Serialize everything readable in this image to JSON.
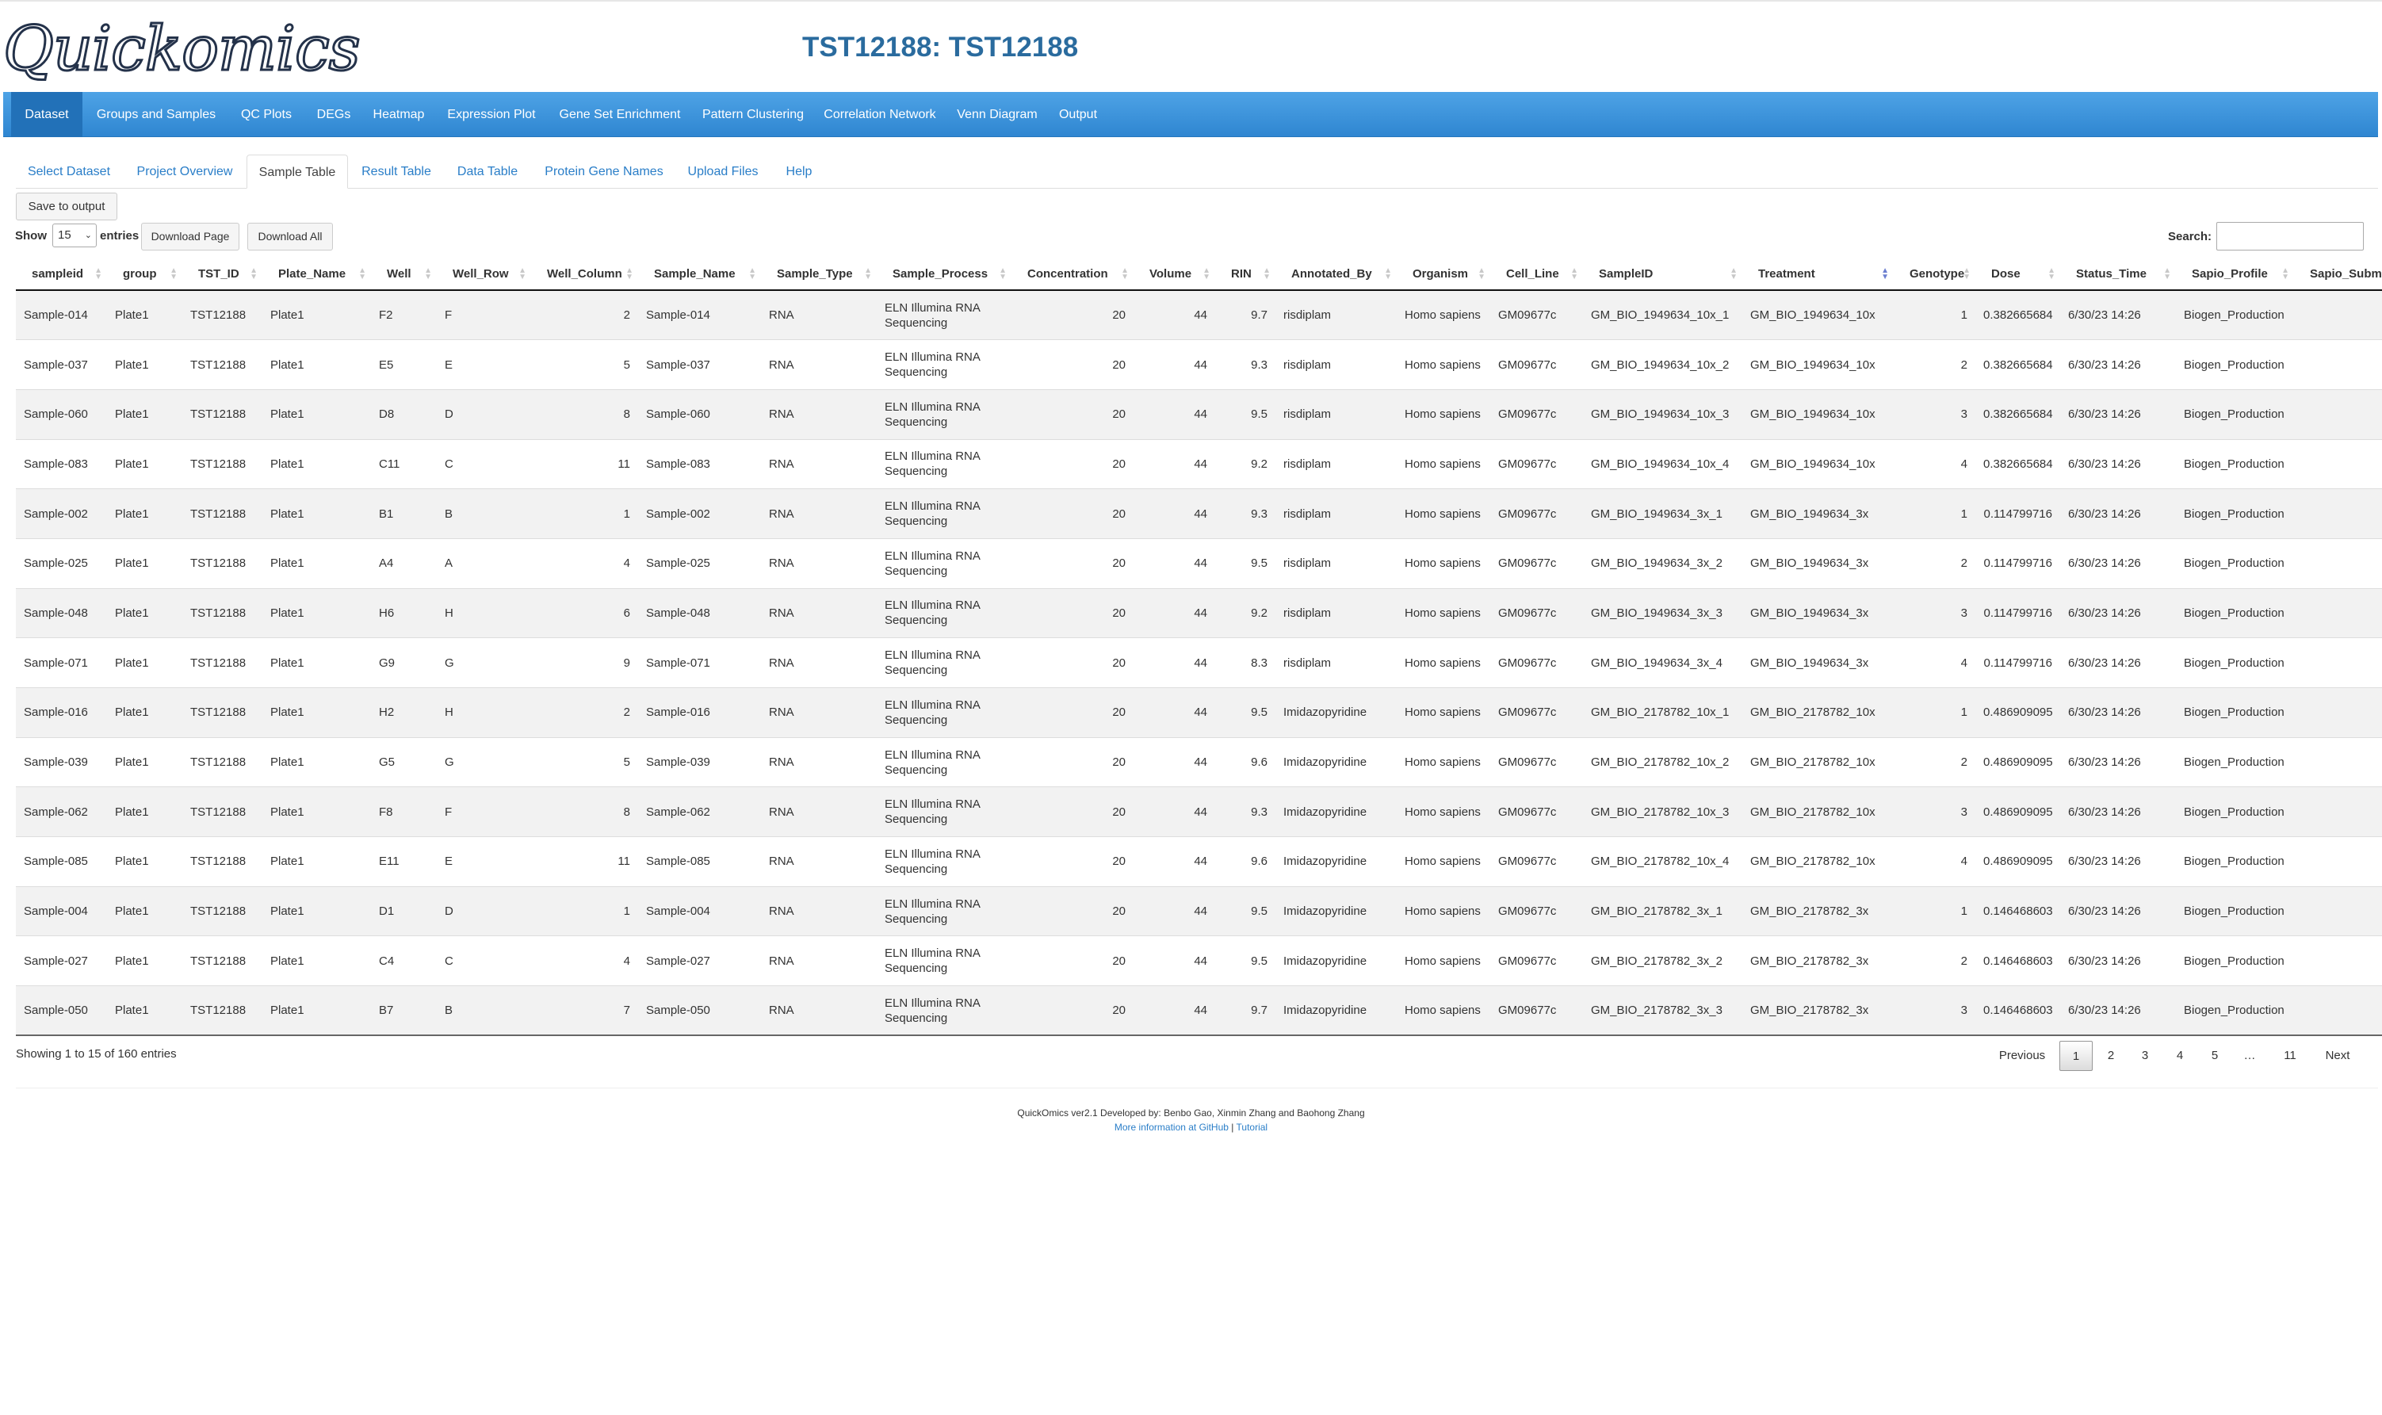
{
  "app": {
    "logo_text": "Quickomics",
    "title": "TST12188: TST12188"
  },
  "navbar": {
    "items": [
      {
        "label": "Dataset",
        "active": true
      },
      {
        "label": "Groups and Samples"
      },
      {
        "label": "QC Plots"
      },
      {
        "label": "DEGs"
      },
      {
        "label": "Heatmap"
      },
      {
        "label": "Expression Plot"
      },
      {
        "label": "Gene Set Enrichment"
      },
      {
        "label": "Pattern Clustering"
      },
      {
        "label": "Correlation Network"
      },
      {
        "label": "Venn Diagram"
      },
      {
        "label": "Output"
      }
    ]
  },
  "tabs": {
    "items": [
      {
        "label": "Select Dataset"
      },
      {
        "label": "Project Overview"
      },
      {
        "label": "Sample Table",
        "active": true
      },
      {
        "label": "Result Table"
      },
      {
        "label": "Data Table"
      },
      {
        "label": "Protein Gene Names"
      },
      {
        "label": "Upload Files"
      },
      {
        "label": "Help"
      }
    ]
  },
  "controls": {
    "save_label": "Save to output",
    "show_label": "Show",
    "entries_value": "15",
    "entries_label": "entries",
    "download_page_label": "Download Page",
    "download_all_label": "Download All",
    "search_label": "Search:",
    "search_value": ""
  },
  "table": {
    "sorted_column": "Treatment",
    "columns": [
      "sampleid",
      "group",
      "TST_ID",
      "Plate_Name",
      "Well",
      "Well_Row",
      "Well_Column",
      "Sample_Name",
      "Sample_Type",
      "Sample_Process",
      "Concentration",
      "Volume",
      "RIN",
      "Annotated_By",
      "Organism",
      "Cell_Line",
      "SampleID",
      "Treatment",
      "Genotype",
      "Dose",
      "Status_Time",
      "Sapio_Profile",
      "Sapio_Subm"
    ],
    "rows": [
      [
        "Sample-014",
        "Plate1",
        "TST12188",
        "Plate1",
        "F2",
        "F",
        "2",
        "Sample-014",
        "RNA",
        "ELN Illumina RNA Sequencing",
        "20",
        "44",
        "9.7",
        "risdiplam",
        "Homo sapiens",
        "GM09677c",
        "GM_BIO_1949634_10x_1",
        "GM_BIO_1949634_10x",
        "1",
        "0.382665684",
        "6/30/23 14:26",
        "Biogen_Production",
        ""
      ],
      [
        "Sample-037",
        "Plate1",
        "TST12188",
        "Plate1",
        "E5",
        "E",
        "5",
        "Sample-037",
        "RNA",
        "ELN Illumina RNA Sequencing",
        "20",
        "44",
        "9.3",
        "risdiplam",
        "Homo sapiens",
        "GM09677c",
        "GM_BIO_1949634_10x_2",
        "GM_BIO_1949634_10x",
        "2",
        "0.382665684",
        "6/30/23 14:26",
        "Biogen_Production",
        ""
      ],
      [
        "Sample-060",
        "Plate1",
        "TST12188",
        "Plate1",
        "D8",
        "D",
        "8",
        "Sample-060",
        "RNA",
        "ELN Illumina RNA Sequencing",
        "20",
        "44",
        "9.5",
        "risdiplam",
        "Homo sapiens",
        "GM09677c",
        "GM_BIO_1949634_10x_3",
        "GM_BIO_1949634_10x",
        "3",
        "0.382665684",
        "6/30/23 14:26",
        "Biogen_Production",
        ""
      ],
      [
        "Sample-083",
        "Plate1",
        "TST12188",
        "Plate1",
        "C11",
        "C",
        "11",
        "Sample-083",
        "RNA",
        "ELN Illumina RNA Sequencing",
        "20",
        "44",
        "9.2",
        "risdiplam",
        "Homo sapiens",
        "GM09677c",
        "GM_BIO_1949634_10x_4",
        "GM_BIO_1949634_10x",
        "4",
        "0.382665684",
        "6/30/23 14:26",
        "Biogen_Production",
        ""
      ],
      [
        "Sample-002",
        "Plate1",
        "TST12188",
        "Plate1",
        "B1",
        "B",
        "1",
        "Sample-002",
        "RNA",
        "ELN Illumina RNA Sequencing",
        "20",
        "44",
        "9.3",
        "risdiplam",
        "Homo sapiens",
        "GM09677c",
        "GM_BIO_1949634_3x_1",
        "GM_BIO_1949634_3x",
        "1",
        "0.114799716",
        "6/30/23 14:26",
        "Biogen_Production",
        ""
      ],
      [
        "Sample-025",
        "Plate1",
        "TST12188",
        "Plate1",
        "A4",
        "A",
        "4",
        "Sample-025",
        "RNA",
        "ELN Illumina RNA Sequencing",
        "20",
        "44",
        "9.5",
        "risdiplam",
        "Homo sapiens",
        "GM09677c",
        "GM_BIO_1949634_3x_2",
        "GM_BIO_1949634_3x",
        "2",
        "0.114799716",
        "6/30/23 14:26",
        "Biogen_Production",
        ""
      ],
      [
        "Sample-048",
        "Plate1",
        "TST12188",
        "Plate1",
        "H6",
        "H",
        "6",
        "Sample-048",
        "RNA",
        "ELN Illumina RNA Sequencing",
        "20",
        "44",
        "9.2",
        "risdiplam",
        "Homo sapiens",
        "GM09677c",
        "GM_BIO_1949634_3x_3",
        "GM_BIO_1949634_3x",
        "3",
        "0.114799716",
        "6/30/23 14:26",
        "Biogen_Production",
        ""
      ],
      [
        "Sample-071",
        "Plate1",
        "TST12188",
        "Plate1",
        "G9",
        "G",
        "9",
        "Sample-071",
        "RNA",
        "ELN Illumina RNA Sequencing",
        "20",
        "44",
        "8.3",
        "risdiplam",
        "Homo sapiens",
        "GM09677c",
        "GM_BIO_1949634_3x_4",
        "GM_BIO_1949634_3x",
        "4",
        "0.114799716",
        "6/30/23 14:26",
        "Biogen_Production",
        ""
      ],
      [
        "Sample-016",
        "Plate1",
        "TST12188",
        "Plate1",
        "H2",
        "H",
        "2",
        "Sample-016",
        "RNA",
        "ELN Illumina RNA Sequencing",
        "20",
        "44",
        "9.5",
        "Imidazopyridine",
        "Homo sapiens",
        "GM09677c",
        "GM_BIO_2178782_10x_1",
        "GM_BIO_2178782_10x",
        "1",
        "0.486909095",
        "6/30/23 14:26",
        "Biogen_Production",
        ""
      ],
      [
        "Sample-039",
        "Plate1",
        "TST12188",
        "Plate1",
        "G5",
        "G",
        "5",
        "Sample-039",
        "RNA",
        "ELN Illumina RNA Sequencing",
        "20",
        "44",
        "9.6",
        "Imidazopyridine",
        "Homo sapiens",
        "GM09677c",
        "GM_BIO_2178782_10x_2",
        "GM_BIO_2178782_10x",
        "2",
        "0.486909095",
        "6/30/23 14:26",
        "Biogen_Production",
        ""
      ],
      [
        "Sample-062",
        "Plate1",
        "TST12188",
        "Plate1",
        "F8",
        "F",
        "8",
        "Sample-062",
        "RNA",
        "ELN Illumina RNA Sequencing",
        "20",
        "44",
        "9.3",
        "Imidazopyridine",
        "Homo sapiens",
        "GM09677c",
        "GM_BIO_2178782_10x_3",
        "GM_BIO_2178782_10x",
        "3",
        "0.486909095",
        "6/30/23 14:26",
        "Biogen_Production",
        ""
      ],
      [
        "Sample-085",
        "Plate1",
        "TST12188",
        "Plate1",
        "E11",
        "E",
        "11",
        "Sample-085",
        "RNA",
        "ELN Illumina RNA Sequencing",
        "20",
        "44",
        "9.6",
        "Imidazopyridine",
        "Homo sapiens",
        "GM09677c",
        "GM_BIO_2178782_10x_4",
        "GM_BIO_2178782_10x",
        "4",
        "0.486909095",
        "6/30/23 14:26",
        "Biogen_Production",
        ""
      ],
      [
        "Sample-004",
        "Plate1",
        "TST12188",
        "Plate1",
        "D1",
        "D",
        "1",
        "Sample-004",
        "RNA",
        "ELN Illumina RNA Sequencing",
        "20",
        "44",
        "9.5",
        "Imidazopyridine",
        "Homo sapiens",
        "GM09677c",
        "GM_BIO_2178782_3x_1",
        "GM_BIO_2178782_3x",
        "1",
        "0.146468603",
        "6/30/23 14:26",
        "Biogen_Production",
        ""
      ],
      [
        "Sample-027",
        "Plate1",
        "TST12188",
        "Plate1",
        "C4",
        "C",
        "4",
        "Sample-027",
        "RNA",
        "ELN Illumina RNA Sequencing",
        "20",
        "44",
        "9.5",
        "Imidazopyridine",
        "Homo sapiens",
        "GM09677c",
        "GM_BIO_2178782_3x_2",
        "GM_BIO_2178782_3x",
        "2",
        "0.146468603",
        "6/30/23 14:26",
        "Biogen_Production",
        ""
      ],
      [
        "Sample-050",
        "Plate1",
        "TST12188",
        "Plate1",
        "B7",
        "B",
        "7",
        "Sample-050",
        "RNA",
        "ELN Illumina RNA Sequencing",
        "20",
        "44",
        "9.7",
        "Imidazopyridine",
        "Homo sapiens",
        "GM09677c",
        "GM_BIO_2178782_3x_3",
        "GM_BIO_2178782_3x",
        "3",
        "0.146468603",
        "6/30/23 14:26",
        "Biogen_Production",
        ""
      ]
    ]
  },
  "info": "Showing 1 to 15 of 160 entries",
  "pagination": {
    "previous": "Previous",
    "pages": [
      "1",
      "2",
      "3",
      "4",
      "5",
      "…",
      "11"
    ],
    "current": "1",
    "next": "Next"
  },
  "footer": {
    "line1": "QuickOmics ver2.1 Developed by: Benbo Gao, Xinmin Zhang and Baohong Zhang",
    "github_link": "More information at GitHub",
    "separator": "|",
    "tutorial_link": "Tutorial"
  },
  "colors": {
    "navbar": "#3a94dc",
    "navbar_active": "#2271b8",
    "title": "#2a6b9e",
    "link": "#2a7ec8",
    "row_stripe": "#f2f2f2"
  }
}
